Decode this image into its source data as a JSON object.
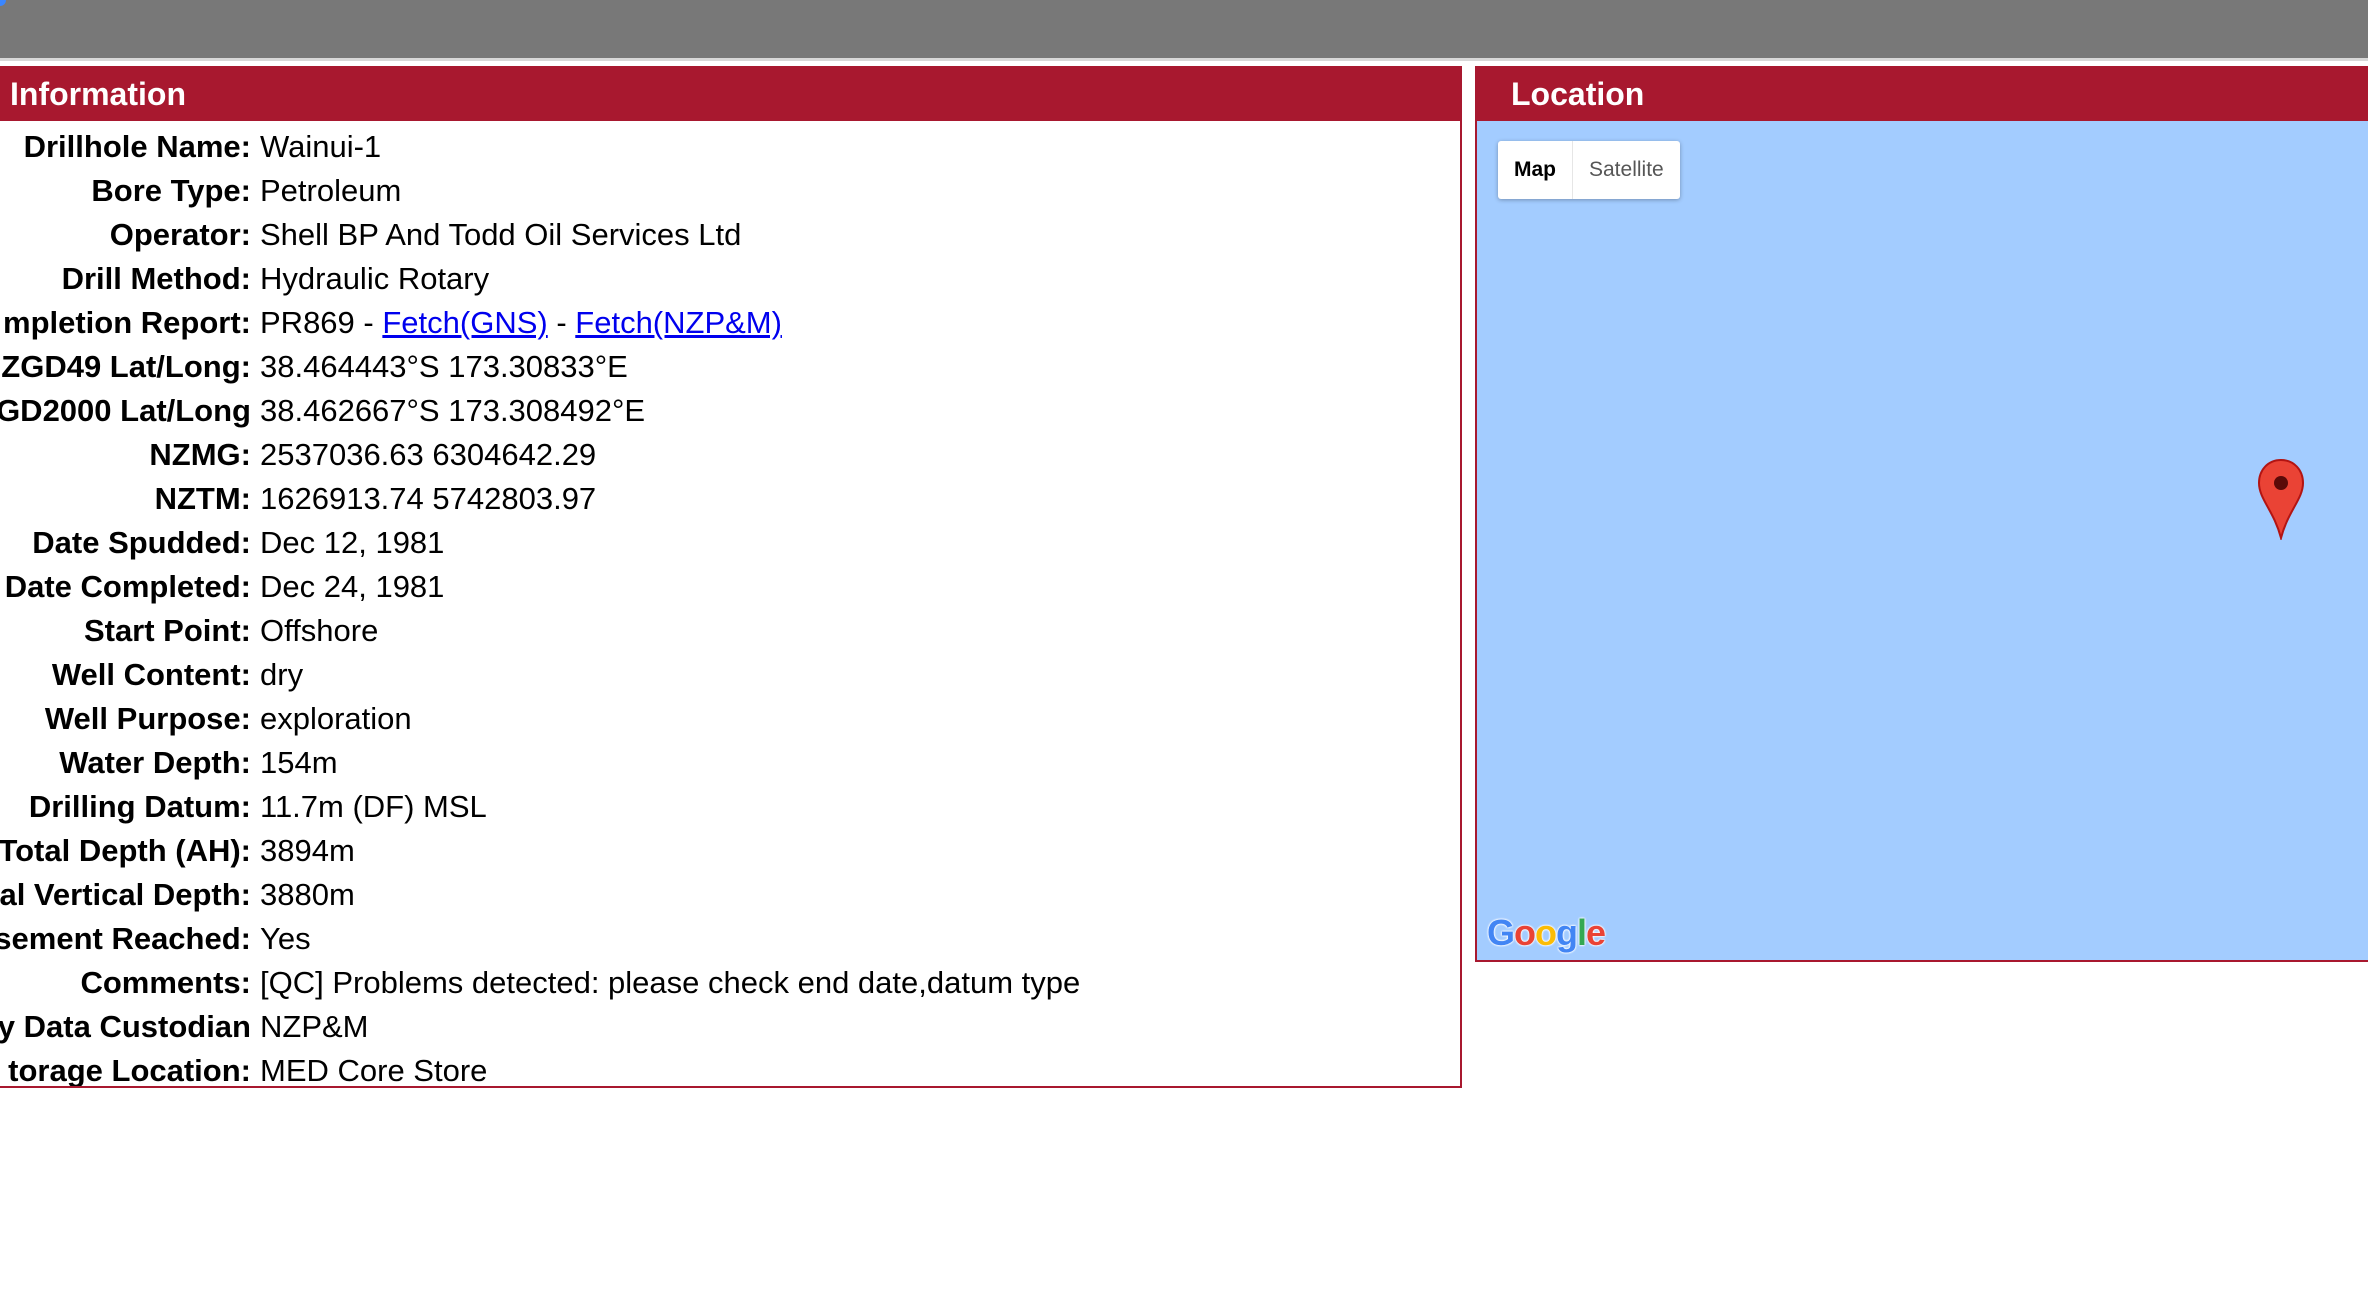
{
  "information": {
    "title": "Information",
    "rows": [
      {
        "label": "Drillhole Name:",
        "value": "Wainui-1"
      },
      {
        "label": "Bore Type:",
        "value": "Petroleum"
      },
      {
        "label": "Operator:",
        "value": "Shell BP And Todd Oil Services Ltd"
      },
      {
        "label": "Drill Method:",
        "value": "Hydraulic Rotary"
      },
      {
        "label": "mpletion Report:",
        "value": "PR869",
        "sep1": " - ",
        "link1": "Fetch(GNS)",
        "sep2": " - ",
        "link2": "Fetch(NZP&M)"
      },
      {
        "label": "ZGD49 Lat/Long:",
        "value": "38.464443°S 173.30833°E"
      },
      {
        "label": "GD2000 Lat/Long",
        "value": "38.462667°S 173.308492°E"
      },
      {
        "label": "NZMG:",
        "value": "2537036.63 6304642.29"
      },
      {
        "label": "NZTM:",
        "value": "1626913.74 5742803.97"
      },
      {
        "label": "Date Spudded:",
        "value": "Dec 12, 1981"
      },
      {
        "label": "Date Completed:",
        "value": "Dec 24, 1981"
      },
      {
        "label": "Start Point:",
        "value": "Offshore"
      },
      {
        "label": "Well Content:",
        "value": "dry"
      },
      {
        "label": "Well Purpose:",
        "value": "exploration"
      },
      {
        "label": "Water Depth:",
        "value": "154m"
      },
      {
        "label": "Drilling Datum:",
        "value": "11.7m (DF) MSL"
      },
      {
        "label": "Total Depth (AH):",
        "value": "3894m"
      },
      {
        "label": "al Vertical Depth:",
        "value": "3880m"
      },
      {
        "label": "sement Reached:",
        "value": "Yes"
      },
      {
        "label": "Comments:",
        "value": "[QC] Problems detected: please check end date,datum type"
      },
      {
        "label": "y Data Custodian",
        "value": "NZP&M"
      },
      {
        "label": "torage Location:",
        "value": "MED Core Store"
      }
    ]
  },
  "location": {
    "title": "Location",
    "map_type": {
      "map_label": "Map",
      "satellite_label": "Satellite",
      "selected": "Map"
    },
    "logo": "Google",
    "marker_icon": "map-marker-icon",
    "colors": {
      "water": "#a3ccff",
      "header": "#a8182f",
      "marker": "#ea4335"
    }
  }
}
